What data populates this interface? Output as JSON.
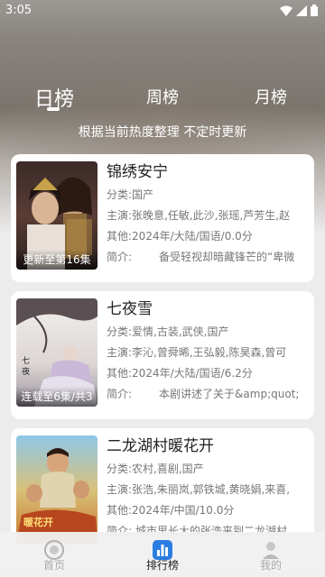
{
  "status_bar": {
    "time": "3:05"
  },
  "tabs": [
    {
      "label": "日榜",
      "active": true
    },
    {
      "label": "周榜",
      "active": false
    },
    {
      "label": "月榜",
      "active": false
    }
  ],
  "subtitle": "根据当前热度整理 不定时更新",
  "items": [
    {
      "title": "锦绣安宁",
      "badge": "更新至第16集",
      "category_label": "分类:",
      "category": "国产",
      "cast_label": "主演:",
      "cast": "张晚意,任敏,此沙,张瑶,芦芳生,赵",
      "other_label": "其他:",
      "other": "2024年/大陆/国语/0.0分",
      "intro_label": "简介:",
      "intro": "备受轻视却暗藏锋芒的“卑微"
    },
    {
      "title": "七夜雪",
      "badge": "连载至6集/共3",
      "category_label": "分类:",
      "category": "爱情,古装,武侠,国产",
      "cast_label": "主演:",
      "cast": "李沁,曾舜晞,王弘毅,陈昊森,曾可",
      "other_label": "其他:",
      "other": "2024年/大陆/国语/6.2分",
      "intro_label": "简介:",
      "intro": "本剧讲述了关于&amp;quot;"
    },
    {
      "title": "二龙湖村暖花开",
      "badge": "",
      "category_label": "分类:",
      "category": "农村,喜剧,国产",
      "cast_label": "主演:",
      "cast": "张浩,朱丽岚,郭铁城,黄晓娟,来喜,",
      "other_label": "其他:",
      "other": "2024年/中国/10.0分",
      "intro_label": "简介:",
      "intro": "城市里长大的张浩来到二龙湖村"
    }
  ],
  "bottom_nav": [
    {
      "label": "首页",
      "icon": "home-icon",
      "active": false
    },
    {
      "label": "排行榜",
      "icon": "ranking-icon",
      "active": true
    },
    {
      "label": "我的",
      "icon": "profile-icon",
      "active": false
    }
  ],
  "colors": {
    "active_nav": "#222222",
    "inactive_nav": "#aaaaaa",
    "accent": "#2a7de1"
  }
}
